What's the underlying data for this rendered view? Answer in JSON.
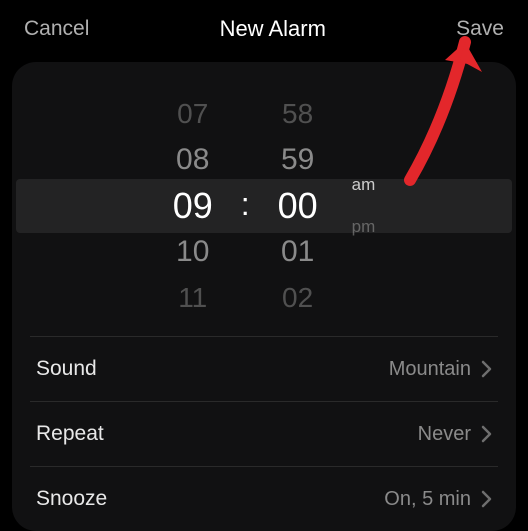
{
  "header": {
    "cancel": "Cancel",
    "title": "New Alarm",
    "save": "Save"
  },
  "picker": {
    "hours": [
      "07",
      "08",
      "09",
      "10",
      "11"
    ],
    "minutes": [
      "58",
      "59",
      "00",
      "01",
      "02"
    ],
    "selected_hour_index": 2,
    "selected_minute_index": 2,
    "ampm": [
      "am",
      "pm"
    ],
    "selected_ampm_index": 0,
    "colon": ":"
  },
  "settings": [
    {
      "label": "Sound",
      "value": "Mountain"
    },
    {
      "label": "Repeat",
      "value": "Never"
    },
    {
      "label": "Snooze",
      "value": "On, 5 min"
    }
  ]
}
